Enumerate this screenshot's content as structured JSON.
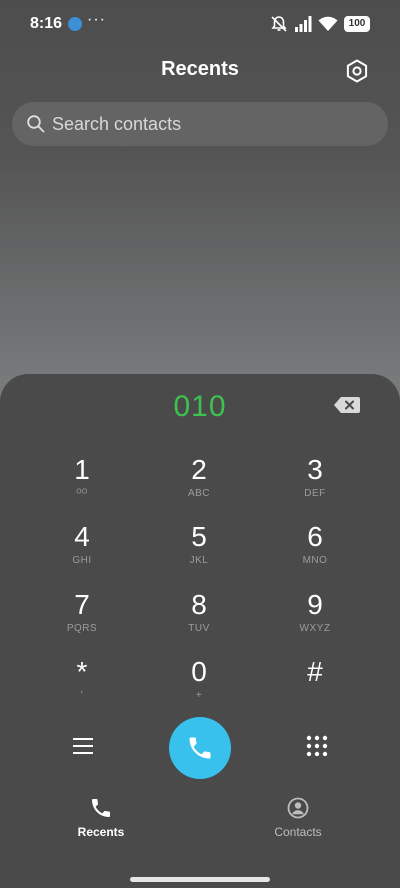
{
  "status_bar": {
    "time": "8:16",
    "more": "···",
    "battery": "100"
  },
  "header": {
    "title": "Recents"
  },
  "search": {
    "placeholder": "Search contacts",
    "value": ""
  },
  "dialer": {
    "number": "010",
    "keys": [
      {
        "digit": "1",
        "letters": "ᴼᴼ"
      },
      {
        "digit": "2",
        "letters": "ABC"
      },
      {
        "digit": "3",
        "letters": "DEF"
      },
      {
        "digit": "4",
        "letters": "GHI"
      },
      {
        "digit": "5",
        "letters": "JKL"
      },
      {
        "digit": "6",
        "letters": "MNO"
      },
      {
        "digit": "7",
        "letters": "PQRS"
      },
      {
        "digit": "8",
        "letters": "TUV"
      },
      {
        "digit": "9",
        "letters": "WXYZ"
      },
      {
        "digit": "*",
        "letters": "'"
      },
      {
        "digit": "0",
        "letters": "+"
      },
      {
        "digit": "#",
        "letters": ""
      }
    ]
  },
  "bottom_nav": {
    "recents_label": "Recents",
    "contacts_label": "Contacts"
  },
  "colors": {
    "accent_green": "#3dc24f",
    "call_blue": "#38c1ec",
    "panel": "#4a4a4a"
  },
  "icons": {
    "settings": "gear-icon",
    "search": "search-icon",
    "backspace": "backspace-icon",
    "menu": "menu-icon",
    "call": "phone-icon",
    "dialpad": "dialpad-icon",
    "recents": "phone-icon",
    "contacts": "person-icon"
  }
}
